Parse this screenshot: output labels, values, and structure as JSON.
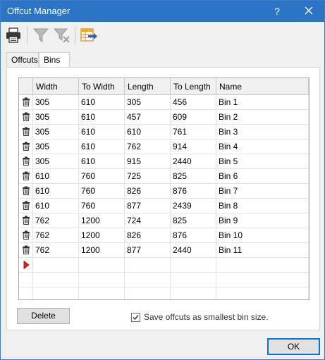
{
  "window": {
    "title": "Offcut Manager",
    "help_glyph": "?",
    "accent_color": "#2b74c6"
  },
  "toolbar": {
    "buttons": [
      {
        "name": "print-icon"
      },
      {
        "name": "filter-icon",
        "enabled": false
      },
      {
        "name": "clear-filter-icon",
        "enabled": false
      },
      {
        "name": "export-icon"
      }
    ]
  },
  "tabs": [
    {
      "label": "Offcuts",
      "active": false
    },
    {
      "label": "Bins",
      "active": true
    }
  ],
  "grid": {
    "columns": [
      "Width",
      "To Width",
      "Length",
      "To Length",
      "Name"
    ],
    "rows": [
      [
        "305",
        "610",
        "305",
        "456",
        "Bin 1"
      ],
      [
        "305",
        "610",
        "457",
        "609",
        "Bin 2"
      ],
      [
        "305",
        "610",
        "610",
        "761",
        "Bin 3"
      ],
      [
        "305",
        "610",
        "762",
        "914",
        "Bin 4"
      ],
      [
        "305",
        "610",
        "915",
        "2440",
        "Bin 5"
      ],
      [
        "610",
        "760",
        "725",
        "825",
        "Bin 6"
      ],
      [
        "610",
        "760",
        "826",
        "876",
        "Bin 7"
      ],
      [
        "610",
        "760",
        "877",
        "2439",
        "Bin 8"
      ],
      [
        "762",
        "1200",
        "724",
        "825",
        "Bin 9"
      ],
      [
        "762",
        "1200",
        "826",
        "876",
        "Bin 10"
      ],
      [
        "762",
        "1200",
        "877",
        "2440",
        "Bin 11"
      ]
    ]
  },
  "actions": {
    "delete_label": "Delete",
    "save_offcuts_label": "Save offcuts as smallest bin size.",
    "save_offcuts_checked": true,
    "ok_label": "OK"
  }
}
